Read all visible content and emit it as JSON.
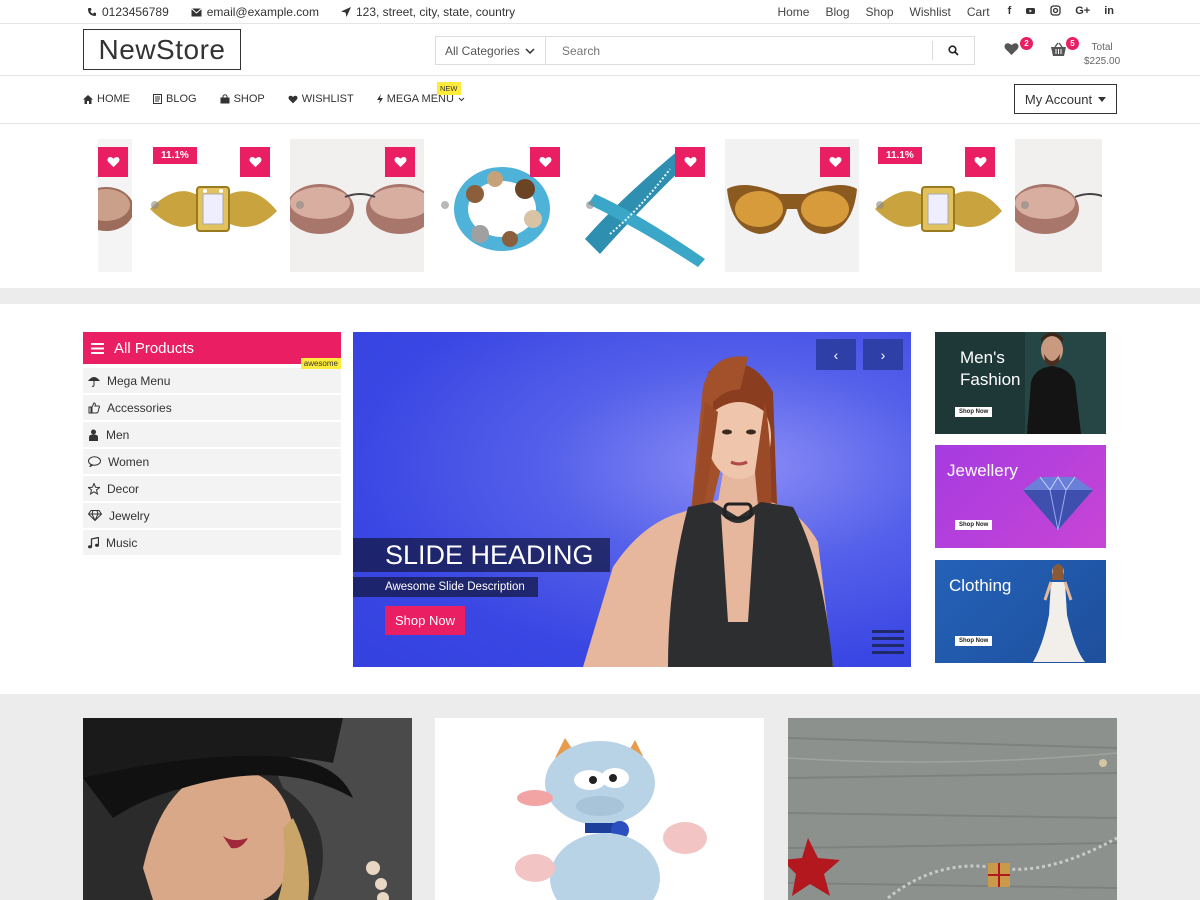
{
  "topbar": {
    "phone": "0123456789",
    "email": "email@example.com",
    "address": "123, street, city, state, country",
    "links": [
      "Home",
      "Blog",
      "Shop",
      "Wishlist",
      "Cart"
    ],
    "social": [
      "facebook-icon",
      "youtube-icon",
      "instagram-icon",
      "google-plus-icon",
      "linkedin-icon"
    ]
  },
  "header": {
    "logo": "NewStore",
    "category": "All Categories",
    "search_placeholder": "Search",
    "wishlist_count": "2",
    "cart_count": "5",
    "total_label": "Total",
    "total_value": "$225.00"
  },
  "nav": {
    "items": [
      {
        "icon": "home-icon",
        "label": "HOME"
      },
      {
        "icon": "blog-icon",
        "label": "BLOG"
      },
      {
        "icon": "bag-icon",
        "label": "SHOP"
      },
      {
        "icon": "heart-icon",
        "label": "WISHLIST"
      },
      {
        "icon": "bolt-icon",
        "label": "MEGA MENU"
      }
    ],
    "new_tag": "NEW",
    "account": "My Account"
  },
  "carousel": {
    "discount": "11.1%",
    "products": [
      "watch",
      "sunglasses",
      "bracelet",
      "bangle",
      "sunglasses",
      "watch",
      "sunglasses"
    ]
  },
  "all_products": {
    "title": "All Products",
    "items": [
      {
        "icon": "umbrella-icon",
        "label": "Mega Menu"
      },
      {
        "icon": "thumbs-up-icon",
        "label": "Accessories"
      },
      {
        "icon": "person-icon",
        "label": "Men"
      },
      {
        "icon": "comment-icon",
        "label": "Women"
      },
      {
        "icon": "star-icon",
        "label": "Decor"
      },
      {
        "icon": "diamond-icon",
        "label": "Jewelry"
      },
      {
        "icon": "music-icon",
        "label": "Music"
      }
    ],
    "badge": "awesome"
  },
  "slider": {
    "heading": "SLIDE HEADING",
    "description": "Awesome Slide Description",
    "button": "Shop Now",
    "prev": "‹",
    "next": "›"
  },
  "promos": [
    {
      "title_line1": "Men's",
      "title_line2": "Fashion",
      "button": "Shop Now",
      "color": "#1f3a3a"
    },
    {
      "title_line1": "Jewellery",
      "title_line2": "",
      "button": "Shop Now",
      "color": "#b23ed8"
    },
    {
      "title_line1": "Clothing",
      "title_line2": "",
      "button": "Shop Now",
      "color": "#2a5ba8"
    }
  ],
  "colors": {
    "accent": "#e91e63",
    "slider": "#3a47e3",
    "badge_yellow": "#ffeb3b"
  }
}
